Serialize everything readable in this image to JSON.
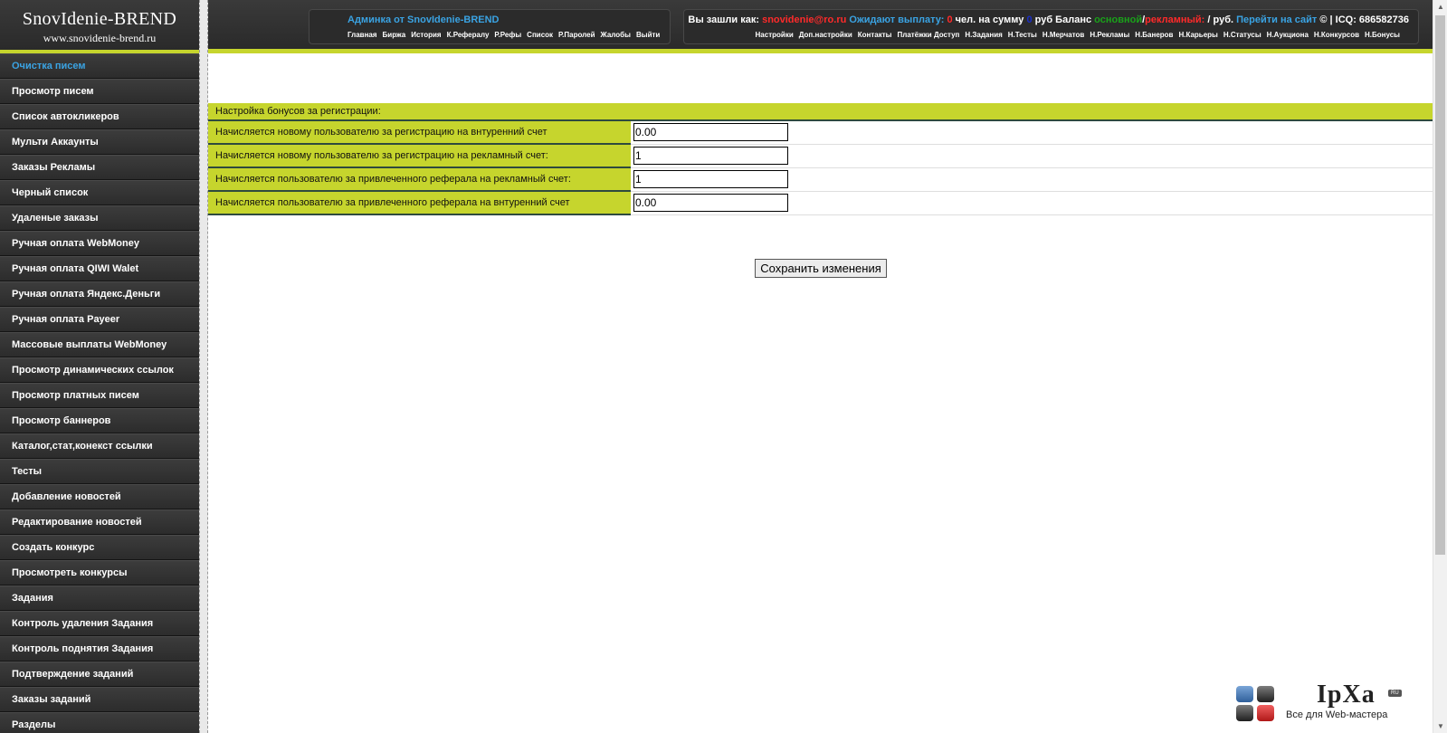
{
  "sidebar": {
    "logo_title": "SnovIdenie-BREND",
    "logo_url": "www.snovidenie-brend.ru",
    "items": [
      {
        "label": "Очистка писем",
        "active": true
      },
      {
        "label": "Просмотр писем"
      },
      {
        "label": "Список автокликеров"
      },
      {
        "label": "Мульти Аккаунты"
      },
      {
        "label": "Заказы Рекламы"
      },
      {
        "label": "Черный список"
      },
      {
        "label": "Удаленые заказы"
      },
      {
        "label": "Ручная оплата WebMoney"
      },
      {
        "label": "Ручная оплата QIWI Walet"
      },
      {
        "label": "Ручная оплата Яндекс.Деньги"
      },
      {
        "label": "Ручная оплата Payeer"
      },
      {
        "label": "Массовые выплаты WebMoney"
      },
      {
        "label": "Просмотр динамических ссылок"
      },
      {
        "label": "Просмотр платных писем"
      },
      {
        "label": "Просмотр баннеров"
      },
      {
        "label": "Каталог,стат,конекст ссылки"
      },
      {
        "label": "Тесты"
      },
      {
        "label": "Добавление новостей"
      },
      {
        "label": "Редактирование новостей"
      },
      {
        "label": "Создать конкурс"
      },
      {
        "label": "Просмотреть конкурсы"
      },
      {
        "label": "Задания"
      },
      {
        "label": "Контроль удаления Задания"
      },
      {
        "label": "Контроль поднятия Задания"
      },
      {
        "label": "Подтверждение заданий"
      },
      {
        "label": "Заказы заданий"
      },
      {
        "label": "Разделы"
      }
    ]
  },
  "header": {
    "left": {
      "title_prefix": "Админка от ",
      "title_brand": "SnovIdenie-BREND",
      "links": [
        "Главная",
        "Биржа",
        "История",
        "К.Рефералу",
        "Р.Рефы",
        "Список",
        "Р.Паролей",
        "Жалобы",
        "Выйти"
      ]
    },
    "right": {
      "logged_in_label": "Вы зашли как:",
      "user_email": "snovidenie@ro.ru",
      "awaiting_label": "Ожидают выплату:",
      "awaiting_count": "0",
      "people_sum_label": "чел. на сумму",
      "sum_value": "0",
      "rub_balance_label": "руб Баланс",
      "balance_main": "основной",
      "slash": "/",
      "balance_ad": "рекламный:",
      "balance_tail": "/ руб.",
      "goto_site": "Перейти на сайт",
      "copyright": "© | ICQ: 686582736",
      "links": [
        "Настройки",
        "Доп.настройки",
        "Контакты",
        "Платёжки Доступ",
        "Н.Задания",
        "Н.Тесты",
        "Н.Мерчатов",
        "Н.Рекламы",
        "Н.Банеров",
        "Н.Карьеры",
        "Н.Статусы",
        "Н.Аукциона",
        "Н.Конкурсов",
        "Н.Бонусы"
      ]
    }
  },
  "settings": {
    "header": "Настройка бонусов за регистрации:",
    "rows": [
      {
        "label": "Начисляется новому пользователю за регистрацию на внтуренний счет",
        "value": "0.00"
      },
      {
        "label": "Начисляется новому пользователю за регистрацию на рекламный счет:",
        "value": "1"
      },
      {
        "label": "Начисляется пользователю за привлеченного реферала на рекламный счет:",
        "value": "1"
      },
      {
        "label": "Начисляется пользователю за привлеченного реферала на внтуренний счет",
        "value": "0.00"
      }
    ],
    "save_label": "Сохранить изменения"
  },
  "watermark": {
    "brand": "IpXa",
    "badge": "RU",
    "tagline": "Все для Web-мастера"
  },
  "colors": {
    "accent": "#c6d52d",
    "header_bg": "#2f2f2f",
    "link_blue": "#3aa3e3",
    "alert_red": "#ff2a2a",
    "balance_green": "#1aa11a"
  }
}
